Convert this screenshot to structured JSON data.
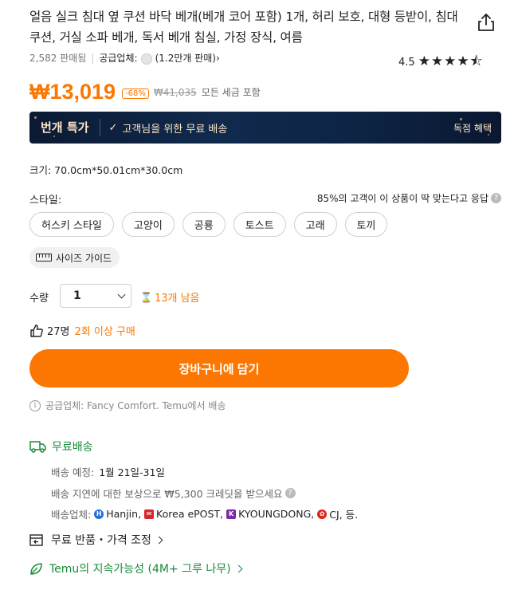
{
  "product": {
    "title": "얼음 실크 침대 옆 쿠션 바닥 베개(베개 코어 포함) 1개, 허리 보호, 대형 등받이, 침대 쿠션, 거실 소파 베개, 독서 베개 침실, 가정 장식, 여름",
    "sold": "2,582 판매됨",
    "supplier_label": "공급업체:",
    "supplier_sales": "(1.2만개 판매)",
    "rating_value": "4.5",
    "rating_stars": "★★★★⯪"
  },
  "price": {
    "current": "₩13,019",
    "discount": "-68%",
    "original": "₩41,035",
    "tax_note": "모든 세금 포함"
  },
  "banner": {
    "flash": "번개 특가",
    "message": "고객님을 위한 무료 배송",
    "exclusive": "독점 혜택"
  },
  "size_text": "크기: 70.0cm*50.01cm*30.0cm",
  "style": {
    "label": "스타일:",
    "fit_note": "85%의 고객이 이 상품이 딱 맞는다고 응답",
    "options": [
      "허스키 스타일",
      "고양이",
      "공룡",
      "토스트",
      "고래",
      "토끼"
    ],
    "size_guide": "사이즈 가이드"
  },
  "quantity": {
    "label": "수량",
    "value": "1",
    "stock": "13개 남음"
  },
  "social": {
    "count": "27명",
    "repeat": "2회 이상 구매"
  },
  "cart_button": "장바구니에 담기",
  "supply_note": "공급업체: Fancy Comfort. Temu에서 배송",
  "shipping": {
    "title": "무료배송",
    "eta_label": "배송 예정:",
    "eta_value": "1월 21일-31일",
    "delay_credit": "배송 지연에 대한 보상으로 ₩5,300 크레딧을 받으세요",
    "carriers_label": "배송업체:",
    "carriers": [
      "Hanjin,",
      "Korea ePOST,",
      "KYOUNGDONG,",
      "CJ, 등."
    ],
    "carrier_colors": [
      "#1e6fd9",
      "#d9262b",
      "#7b2aa8",
      "#e2231a"
    ]
  },
  "returns": "무료 반품・가격 조정",
  "sustainability": "Temu의 지속가능성 (4M+ 그루 나무)",
  "colors": {
    "accent": "#fb7701",
    "green": "#1a8a3a",
    "banner_bg": "#0b1a33"
  }
}
